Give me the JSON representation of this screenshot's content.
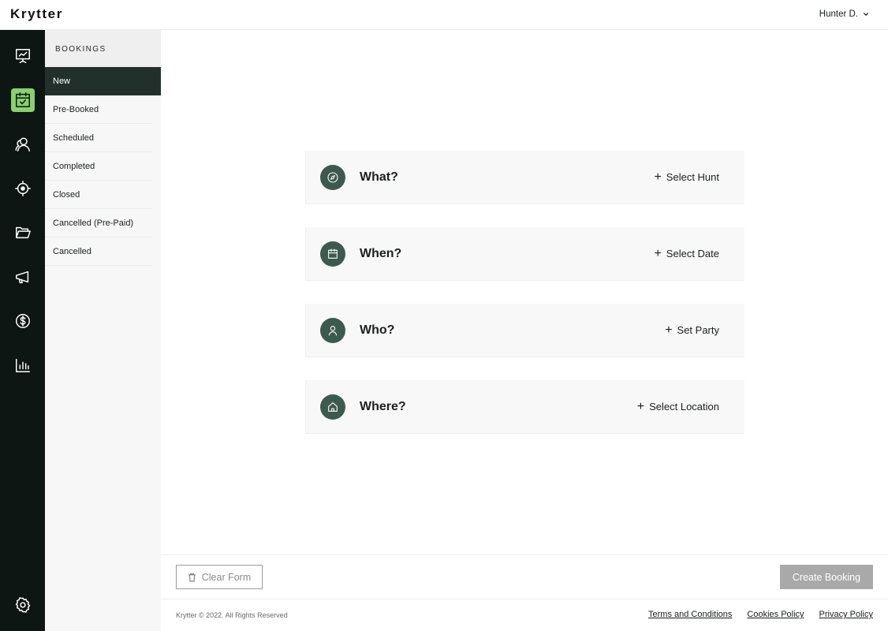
{
  "app": {
    "logo": "Krytter"
  },
  "user": {
    "name": "Hunter D."
  },
  "rail": {
    "items": [
      {
        "icon": "presentation-chart-icon",
        "active": false
      },
      {
        "icon": "calendar-check-icon",
        "active": true
      },
      {
        "icon": "users-icon",
        "active": false
      },
      {
        "icon": "crosshair-icon",
        "active": false
      },
      {
        "icon": "folder-open-icon",
        "active": false
      },
      {
        "icon": "megaphone-icon",
        "active": false
      },
      {
        "icon": "dollar-icon",
        "active": false
      },
      {
        "icon": "bar-chart-icon",
        "active": false
      }
    ],
    "bottom_icon": "gear-icon",
    "accent_color": "#8ad06d",
    "background": "#0d1613"
  },
  "subnav": {
    "heading": "BOOKINGS",
    "items": [
      {
        "label": "New",
        "active": true
      },
      {
        "label": "Pre-Booked",
        "active": false
      },
      {
        "label": "Scheduled",
        "active": false
      },
      {
        "label": "Completed",
        "active": false
      },
      {
        "label": "Closed",
        "active": false
      },
      {
        "label": "Cancelled (Pre-Paid)",
        "active": false
      },
      {
        "label": "Cancelled",
        "active": false
      }
    ]
  },
  "booking_form": {
    "sections": [
      {
        "title": "What?",
        "icon": "compass-icon",
        "action": "Select Hunt"
      },
      {
        "title": "When?",
        "icon": "calendar-icon",
        "action": "Select Date"
      },
      {
        "title": "Who?",
        "icon": "person-icon",
        "action": "Set Party"
      },
      {
        "title": "Where?",
        "icon": "home-icon",
        "action": "Select Location"
      }
    ],
    "icon_circle_color": "#3c5a4e"
  },
  "actions": {
    "clear_label": "Clear Form",
    "create_label": "Create Booking"
  },
  "footer": {
    "copyright": "Krytter © 2022. All Rights Reserved",
    "links": [
      "Terms and Conditions",
      "Cookies Policy",
      "Privacy Policy"
    ]
  }
}
